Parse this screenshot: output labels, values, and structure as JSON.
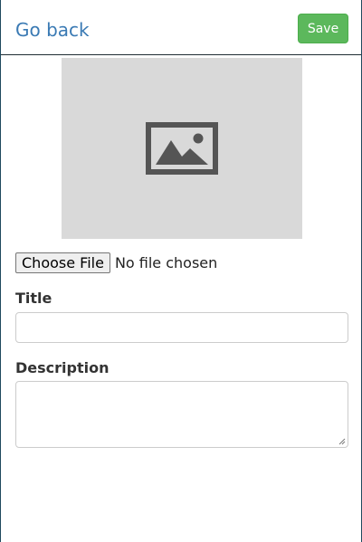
{
  "header": {
    "back_label": "Go back",
    "save_label": "Save"
  },
  "preview": {
    "icon": "image-placeholder-icon"
  },
  "file": {
    "button_label": "Choose File",
    "status": "No file chosen"
  },
  "form": {
    "title_label": "Title",
    "title_value": "",
    "title_placeholder": "",
    "description_label": "Description",
    "description_value": "",
    "description_placeholder": ""
  },
  "colors": {
    "link": "#3a7ab4",
    "save": "#5cb85c",
    "preview_bg": "#d9d9d9"
  }
}
